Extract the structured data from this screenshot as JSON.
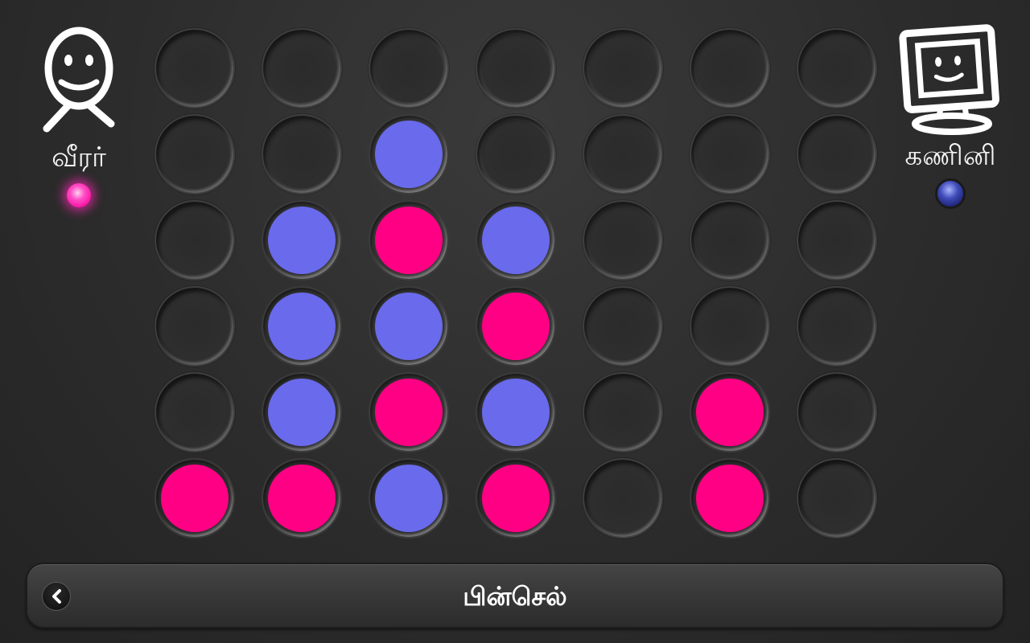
{
  "players": {
    "human": {
      "name": "வீரர்",
      "avatar_icon": "stick-figure-smiley-icon",
      "turn_active": true,
      "color": "#ff0085"
    },
    "computer": {
      "name": "கணினி",
      "avatar_icon": "computer-monitor-smiley-icon",
      "turn_active": false,
      "color": "#6a6aec"
    }
  },
  "board": {
    "columns": 7,
    "rows": 6,
    "cells": [
      [
        "",
        "",
        "",
        "",
        "",
        "",
        ""
      ],
      [
        "",
        "",
        "B",
        "",
        "",
        "",
        ""
      ],
      [
        "",
        "B",
        "P",
        "B",
        "",
        "",
        ""
      ],
      [
        "",
        "B",
        "B",
        "P",
        "",
        "",
        ""
      ],
      [
        "",
        "B",
        "P",
        "B",
        "",
        "P",
        ""
      ],
      [
        "P",
        "P",
        "B",
        "P",
        "",
        "P",
        ""
      ]
    ],
    "colors": {
      "P": "#ff0085",
      "B": "#6a6aec"
    }
  },
  "bottom_bar": {
    "title": "பின்செல்",
    "back_icon": "chevron-left-icon"
  }
}
